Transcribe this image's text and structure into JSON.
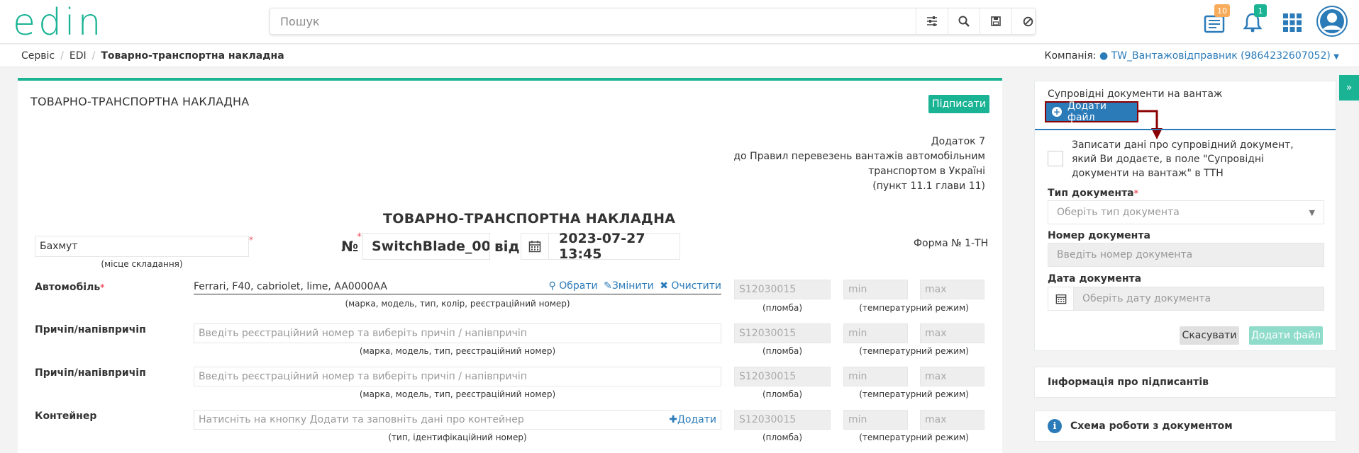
{
  "header": {
    "logo": "edin",
    "search_placeholder": "Пошук",
    "messages_count": "10",
    "notifications_count": "1"
  },
  "breadcrumb": {
    "items": [
      "Сервіс",
      "EDI",
      "Товарно-транспортна накладна"
    ],
    "company_label": "Компанія:",
    "company_name": "TW_Вантажовідправник (9864232607052)"
  },
  "main": {
    "title": "ТОВАРНО-ТРАНСПОРТНА НАКЛАДНА",
    "sign_button": "Підписати",
    "annex_lines": [
      "Додаток 7",
      "до Правил перевезень вантажів автомобільним",
      "транспортом в Україні",
      "(пункт 11.1 глави 11)"
    ],
    "doc_heading": "ТОВАРНО-ТРАНСПОРТНА НАКЛАДНА",
    "place_value": "Бахмут",
    "place_hint": "(місце складання)",
    "number_label": "№",
    "number_value": "SwitchBlade_00:",
    "from_label": "від",
    "date_value": "2023-07-27 13:45",
    "form_label": "Форма № 1-ТН",
    "car": {
      "label": "Автомобіль",
      "value": "Ferrari, F40, cabriolet, lime, AA0000AA",
      "hint": "(марка, модель, тип, колір, реєстраційний номер)",
      "choose": "Обрати",
      "change": "Змінити",
      "clear": "Очистити"
    },
    "trailer1": {
      "label": "Причіп/напівпричіп",
      "placeholder": "Введіть реєстраційний номер та виберіть причіп / напівпричіп",
      "hint": "(марка, модель, тип, реєстраційний номер)"
    },
    "trailer2": {
      "label": "Причіп/напівпричіп",
      "placeholder": "Введіть реєстраційний номер та виберіть причіп / напівпричіп",
      "hint": "(марка, модель, тип, реєстраційний номер)"
    },
    "container": {
      "label": "Контейнер",
      "placeholder": "Натисніть на кнопку Додати та заповніть дані про контейнер",
      "add": "Додати",
      "hint": "(тип, ідентифікаційний номер)"
    },
    "seal_value": "S12030015",
    "seal_hint": "(пломба)",
    "min_placeholder": "min",
    "max_placeholder": "max",
    "temp_hint": "(температурний режим)"
  },
  "right": {
    "title": "Супровідні документи на вантаж",
    "add_file_button": "Додати файл",
    "checkbox_label": "Записати дані про супровідний документ, який Ви додаєте, в поле \"Супровідні документи на вантаж\" в ТТН",
    "doc_type_label": "Тип документа",
    "doc_type_placeholder": "Оберіть тип документа",
    "doc_number_label": "Номер документа",
    "doc_number_placeholder": "Введіть номер документа",
    "doc_date_label": "Дата документа",
    "doc_date_placeholder": "Оберіть дату документа",
    "cancel_button": "Скасувати",
    "submit_button": "Додати файл",
    "signers_title": "Інформація про підписантів",
    "scheme_title": "Схема роботи з документом"
  }
}
